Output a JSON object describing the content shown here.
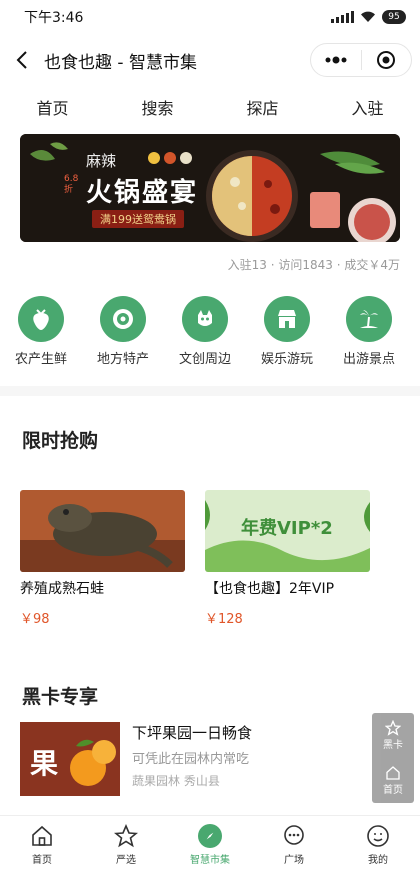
{
  "status_bar": {
    "time": "下午3:46",
    "battery": "95"
  },
  "navbar": {
    "title": "也食也趣 - 智慧市集"
  },
  "tabs": [
    {
      "label": "首页"
    },
    {
      "label": "搜索"
    },
    {
      "label": "探店"
    },
    {
      "label": "入驻"
    }
  ],
  "banner": {
    "small_text": "麻辣",
    "main_text": "火锅盛宴",
    "badge": "6.8折",
    "ribbon": "满199送鸳鸯锅"
  },
  "stats": {
    "text": "入驻13 · 访问1843 · 成交￥4万"
  },
  "categories": [
    {
      "label": "农产生鲜",
      "icon": "strawberry-icon"
    },
    {
      "label": "地方特产",
      "icon": "kiwi-icon"
    },
    {
      "label": "文创周边",
      "icon": "mascot-icon"
    },
    {
      "label": "娱乐游玩",
      "icon": "shop-icon"
    },
    {
      "label": "出游景点",
      "icon": "palm-island-icon"
    }
  ],
  "flash_sale": {
    "title": "限时抢购",
    "items": [
      {
        "name": "养殖成熟石蛙",
        "price": "￥98"
      },
      {
        "name": "【也食也趣】2年VIP",
        "price": "￥128",
        "image_text": "年费VIP*2"
      }
    ]
  },
  "black_card": {
    "title": "黑卡专享",
    "item": {
      "name": "下坪果园一日畅食",
      "subtitle": "可凭此在园林内常吃",
      "location": "蔬果园林  秀山县",
      "image_text": "果"
    }
  },
  "float_buttons": [
    {
      "label": "黑卡"
    },
    {
      "label": "首页"
    }
  ],
  "tabbar": [
    {
      "label": "首页",
      "icon": "house-icon"
    },
    {
      "label": "严选",
      "icon": "star-icon"
    },
    {
      "label": "智慧市集",
      "icon": "compass-icon",
      "active": true
    },
    {
      "label": "广场",
      "icon": "chat-bubble-icon"
    },
    {
      "label": "我的",
      "icon": "smiley-icon"
    }
  ],
  "colors": {
    "accent": "#49a86f",
    "price": "#e0562a"
  }
}
